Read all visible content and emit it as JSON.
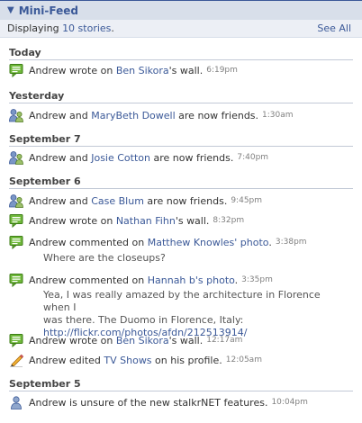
{
  "header": {
    "title": "Mini-Feed"
  },
  "subheader": {
    "prefix": "Displaying ",
    "count_link": "10 stories",
    "suffix": ".",
    "see_all": "See All"
  },
  "sections": {
    "today": "Today",
    "yesterday": "Yesterday",
    "sep7": "September 7",
    "sep6": "September 6",
    "sep5": "September 5"
  },
  "stories": [
    {
      "icon": "wall-post-icon",
      "a": "Andrew wrote on ",
      "link": "Ben Sikora",
      "b": "'s wall.",
      "time": "6:19pm"
    },
    {
      "icon": "friends-icon",
      "a": "Andrew and ",
      "link": "MaryBeth Dowell",
      "b": " are now friends.",
      "time": "1:30am"
    },
    {
      "icon": "friends-icon",
      "a": "Andrew and ",
      "link": "Josie Cotton",
      "b": " are now friends.",
      "time": "7:40pm"
    },
    {
      "icon": "friends-icon",
      "a": "Andrew and ",
      "link": "Case Blum",
      "b": " are now friends.",
      "time": "9:45pm"
    },
    {
      "icon": "wall-post-icon",
      "a": "Andrew wrote on ",
      "link": "Nathan Fihn",
      "b": "'s wall.",
      "time": "8:32pm"
    },
    {
      "icon": "wall-post-icon",
      "a": "Andrew commented on ",
      "link": "Matthew Knowles' photo",
      "b": ".",
      "time": "3:38pm",
      "quote": "Where are the closeups?"
    },
    {
      "icon": "wall-post-icon",
      "a": "Andrew commented on ",
      "link": "Hannah b's photo",
      "b": ".",
      "time": "3:35pm",
      "quote_lines": [
        "Yea, I was really amazed by the architecture in Florence when I",
        "was there. The Duomo in Florence, Italy:"
      ],
      "quote_link": "http://flickr.com/photos/afdn/212513914/"
    },
    {
      "icon": "wall-post-icon",
      "a": "Andrew wrote on ",
      "link": "Ben Sikora",
      "b": "'s wall.",
      "time": "12:17am"
    },
    {
      "icon": "pencil-icon",
      "a": "Andrew edited ",
      "link": "TV Shows",
      "b": " on his profile.",
      "time": "12:05am"
    },
    {
      "icon": "person-icon",
      "a": "Andrew is unsure of the new stalkrNET features.",
      "link": "",
      "b": "",
      "time": "10:04pm"
    }
  ]
}
